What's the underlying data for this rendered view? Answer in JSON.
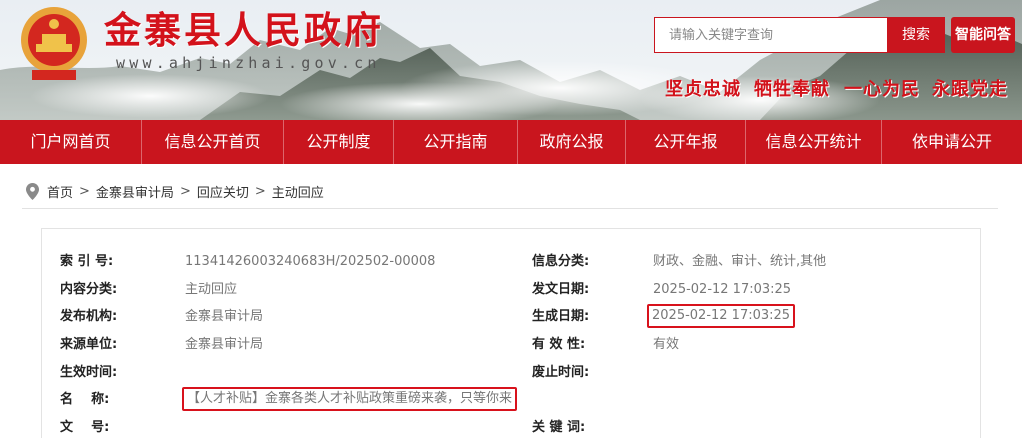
{
  "header": {
    "site_title": "金寨县人民政府",
    "site_url": "www.ahjinzhai.gov.cn",
    "search_placeholder": "请输入关键字查询",
    "search_button": "搜索",
    "ai_button": "智能问答",
    "slogans": [
      "坚贞忠诚",
      "牺牲奉献",
      "一心为民",
      "永跟党走"
    ]
  },
  "nav": {
    "items": [
      "门户网首页",
      "信息公开首页",
      "公开制度",
      "公开指南",
      "政府公报",
      "公开年报",
      "信息公开统计",
      "依申请公开"
    ]
  },
  "breadcrumb": {
    "items": [
      "首页",
      "金寨县审计局",
      "回应关切",
      "主动回应"
    ],
    "separator": ">"
  },
  "meta": {
    "index_no_label": "索 引 号:",
    "index_no": "11341426003240683H/202502-00008",
    "info_category_label": "信息分类:",
    "info_category": "财政、金融、审计、统计,其他",
    "content_category_label": "内容分类:",
    "content_category": "主动回应",
    "issue_date_label": "发文日期:",
    "issue_date": "2025-02-12 17:03:25",
    "publisher_label": "发布机构:",
    "publisher": "金寨县审计局",
    "generate_date_label": "生成日期:",
    "generate_date": "2025-02-12 17:03:25",
    "source_label": "来源单位:",
    "source": "金寨县审计局",
    "validity_label": "有 效 性:",
    "validity": "有效",
    "effective_time_label": "生效时间:",
    "effective_time": "",
    "repeal_time_label": "废止时间:",
    "repeal_time": "",
    "name_label": "名    称:",
    "name": "【人才补贴】金寨各类人才补贴政策重磅来袭，只等你来",
    "doc_no_label": "文    号:",
    "doc_no": "",
    "keywords_label": "关 键 词:",
    "keywords": ""
  },
  "colors": {
    "brand_red": "#c9151e",
    "highlight_red": "#d8121c"
  }
}
